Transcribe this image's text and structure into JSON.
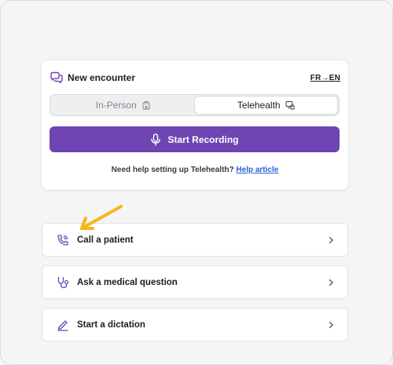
{
  "encounter": {
    "title": "New encounter",
    "language_toggle": "FR→EN",
    "modes": [
      {
        "label": "In-Person",
        "selected": false,
        "icon": "building-icon"
      },
      {
        "label": "Telehealth",
        "selected": true,
        "icon": "video-call-icon"
      }
    ],
    "record_label": "Start Recording",
    "help_text": "Need help setting up Telehealth?",
    "help_link": "Help article"
  },
  "actions": [
    {
      "label": "Call a patient",
      "icon": "phone-icon"
    },
    {
      "label": "Ask a medical question",
      "icon": "stethoscope-icon"
    },
    {
      "label": "Start a dictation",
      "icon": "pen-icon"
    }
  ],
  "colors": {
    "accent": "#6e45b3",
    "link": "#2762d6",
    "annotation_arrow": "#f5b71a"
  }
}
